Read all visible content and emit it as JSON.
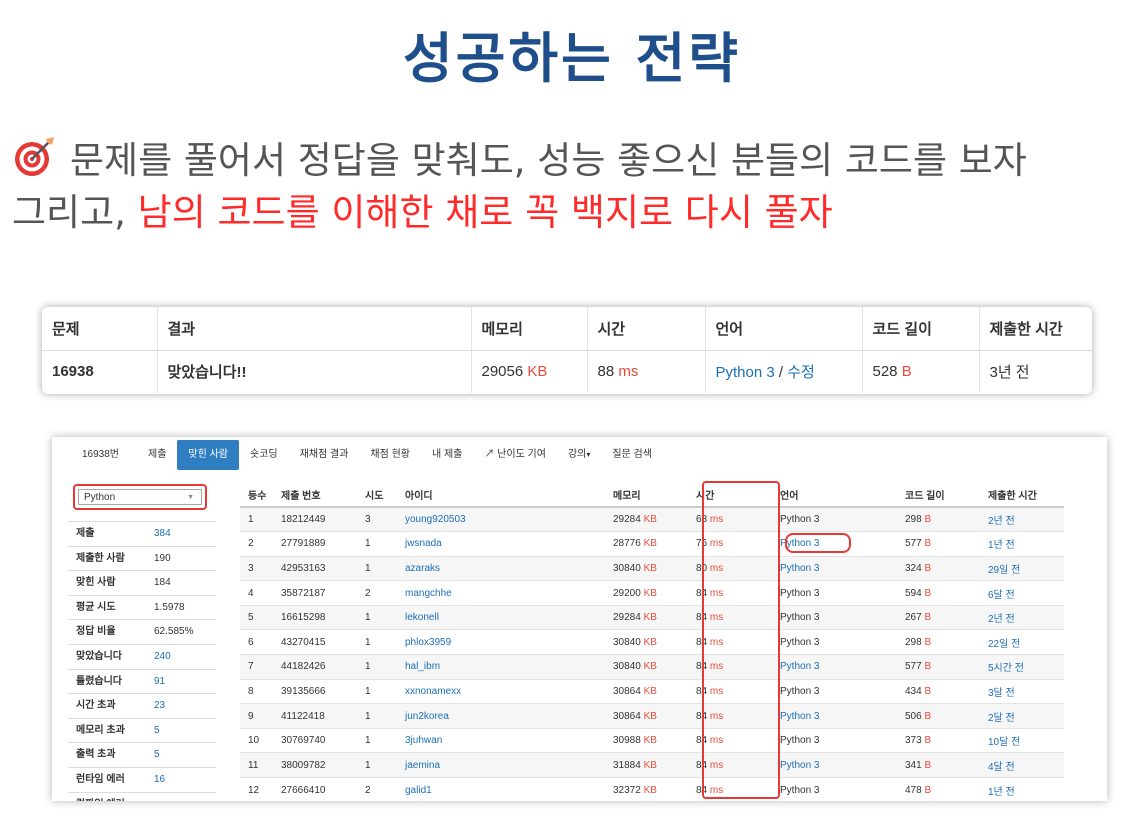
{
  "title": "성공하는 전략",
  "intro": {
    "line1": "문제를 풀어서 정답을 맞춰도, 성능 좋으신 분들의 코드를 보자",
    "line2_plain": "그리고, ",
    "line2_red": "남의 코드를 이해한 채로 꼭 백지로 다시 풀자",
    "icon": "target-dart-icon"
  },
  "result": {
    "headers": [
      "문제",
      "결과",
      "메모리",
      "시간",
      "언어",
      "코드 길이",
      "제출한 시간"
    ],
    "problem": "16938",
    "verdict": "맞았습니다!!",
    "memory": "29056",
    "memory_unit": "KB",
    "time": "88",
    "time_unit": "ms",
    "language": "Python 3",
    "separator": " / ",
    "edit": "수정",
    "code_length": "528",
    "code_unit": "B",
    "submitted": "3년 전"
  },
  "tabs": [
    "16938번",
    "제출",
    "맞힌 사람",
    "숏코딩",
    "재채점 결과",
    "채점 현황",
    "내 제출",
    "난이도 기여",
    "강의",
    "질문 검색"
  ],
  "filter": {
    "selected": "Python"
  },
  "stats": [
    {
      "k": "제출",
      "v": "384",
      "link": true
    },
    {
      "k": "제출한 사람",
      "v": "190",
      "link": false
    },
    {
      "k": "맞힌 사람",
      "v": "184",
      "link": false
    },
    {
      "k": "평균 시도",
      "v": "1.5978",
      "link": false
    },
    {
      "k": "정답 비율",
      "v": "62.585%",
      "link": false
    },
    {
      "k": "맞았습니다",
      "v": "240",
      "link": true
    },
    {
      "k": "틀렸습니다",
      "v": "91",
      "link": true
    },
    {
      "k": "시간 초과",
      "v": "23",
      "link": true
    },
    {
      "k": "메모리 초과",
      "v": "5",
      "link": true
    },
    {
      "k": "출력 초과",
      "v": "5",
      "link": true
    },
    {
      "k": "런타임 에러",
      "v": "16",
      "link": true
    },
    {
      "k": "컴파일 에러",
      "v": "",
      "link": false
    }
  ],
  "ranking": {
    "headers": [
      "등수",
      "제출 번호",
      "시도",
      "아이디",
      "메모리",
      "시간",
      "언어",
      "코드 길이",
      "제출한 시간"
    ],
    "rows": [
      {
        "rank": "1",
        "id": "18212449",
        "tries": "3",
        "user": "young920503",
        "mem": "29284",
        "time": "68",
        "lang": "Python 3",
        "lang_link": false,
        "len": "298",
        "when": "2년 전"
      },
      {
        "rank": "2",
        "id": "27791889",
        "tries": "1",
        "user": "jwsnada",
        "mem": "28776",
        "time": "76",
        "lang": "Python 3",
        "lang_link": true,
        "len": "577",
        "when": "1년 전"
      },
      {
        "rank": "3",
        "id": "42953163",
        "tries": "1",
        "user": "azaraks",
        "mem": "30840",
        "time": "80",
        "lang": "Python 3",
        "lang_link": true,
        "len": "324",
        "when": "29일 전"
      },
      {
        "rank": "4",
        "id": "35872187",
        "tries": "2",
        "user": "mangchhe",
        "mem": "29200",
        "time": "84",
        "lang": "Python 3",
        "lang_link": false,
        "len": "594",
        "when": "6달 전"
      },
      {
        "rank": "5",
        "id": "16615298",
        "tries": "1",
        "user": "lekonell",
        "mem": "29284",
        "time": "84",
        "lang": "Python 3",
        "lang_link": false,
        "len": "267",
        "when": "2년 전"
      },
      {
        "rank": "6",
        "id": "43270415",
        "tries": "1",
        "user": "phlox3959",
        "mem": "30840",
        "time": "84",
        "lang": "Python 3",
        "lang_link": false,
        "len": "298",
        "when": "22일 전"
      },
      {
        "rank": "7",
        "id": "44182426",
        "tries": "1",
        "user": "hal_ibm",
        "mem": "30840",
        "time": "84",
        "lang": "Python 3",
        "lang_link": true,
        "len": "577",
        "when": "5시간 전"
      },
      {
        "rank": "8",
        "id": "39135666",
        "tries": "1",
        "user": "xxnonamexx",
        "mem": "30864",
        "time": "84",
        "lang": "Python 3",
        "lang_link": false,
        "len": "434",
        "when": "3달 전"
      },
      {
        "rank": "9",
        "id": "41122418",
        "tries": "1",
        "user": "jun2korea",
        "mem": "30864",
        "time": "84",
        "lang": "Python 3",
        "lang_link": true,
        "len": "506",
        "when": "2달 전"
      },
      {
        "rank": "10",
        "id": "30769740",
        "tries": "1",
        "user": "3juhwan",
        "mem": "30988",
        "time": "84",
        "lang": "Python 3",
        "lang_link": false,
        "len": "373",
        "when": "10달 전"
      },
      {
        "rank": "11",
        "id": "38009782",
        "tries": "1",
        "user": "jaemina",
        "mem": "31884",
        "time": "84",
        "lang": "Python 3",
        "lang_link": true,
        "len": "341",
        "when": "4달 전"
      },
      {
        "rank": "12",
        "id": "27666410",
        "tries": "2",
        "user": "galid1",
        "mem": "32372",
        "time": "84",
        "lang": "Python 3",
        "lang_link": false,
        "len": "478",
        "when": "1년 전"
      }
    ],
    "units": {
      "mem": "KB",
      "time": "ms",
      "len": "B"
    }
  },
  "colors": {
    "title": "#1f4f8a",
    "highlight": "#ff2a2a",
    "link": "#1b6fb5",
    "verdict": "#009874",
    "active_tab": "#2e7ec1"
  }
}
